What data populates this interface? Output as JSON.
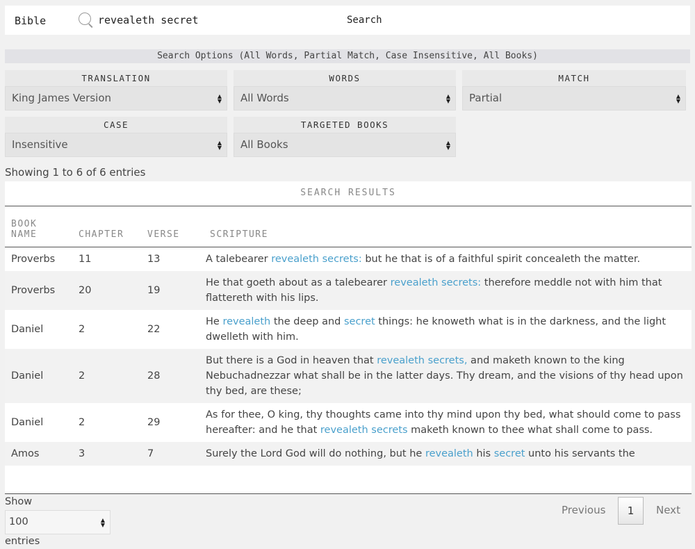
{
  "topbar": {
    "brand": "Bible",
    "search_value": "revealeth secret",
    "search_button": "Search"
  },
  "options": {
    "header": "Search Options (All Words, Partial Match, Case Insensitive, All Books)",
    "translation": {
      "label": "TRANSLATION",
      "value": "King James Version"
    },
    "words": {
      "label": "WORDS",
      "value": "All Words"
    },
    "match": {
      "label": "MATCH",
      "value": "Partial"
    },
    "case": {
      "label": "CASE",
      "value": "Insensitive"
    },
    "books": {
      "label": "TARGETED BOOKS",
      "value": "All Books"
    }
  },
  "showing": "Showing 1 to 6 of 6 entries",
  "results": {
    "title": "SEARCH RESULTS",
    "columns": [
      "BOOK NAME",
      "CHAPTER",
      "VERSE",
      "SCRIPTURE"
    ],
    "highlight_color": "#4aa0cc",
    "rows": [
      {
        "book": "Proverbs",
        "chapter": "11",
        "verse": "13",
        "parts": [
          {
            "t": "A talebearer "
          },
          {
            "t": "revealeth secrets:",
            "hl": true
          },
          {
            "t": " but he that is of a faithful spirit concealeth the matter."
          }
        ]
      },
      {
        "book": "Proverbs",
        "chapter": "20",
        "verse": "19",
        "parts": [
          {
            "t": "He that goeth about as a talebearer "
          },
          {
            "t": "revealeth secrets:",
            "hl": true
          },
          {
            "t": " therefore meddle not with him that flattereth with his lips."
          }
        ]
      },
      {
        "book": "Daniel",
        "chapter": "2",
        "verse": "22",
        "parts": [
          {
            "t": "He "
          },
          {
            "t": "revealeth",
            "hl": true
          },
          {
            "t": " the deep and "
          },
          {
            "t": "secret",
            "hl": true
          },
          {
            "t": " things: he knoweth what is in the darkness, and the light dwelleth with him."
          }
        ]
      },
      {
        "book": "Daniel",
        "chapter": "2",
        "verse": "28",
        "parts": [
          {
            "t": "But there is a God in heaven that "
          },
          {
            "t": "revealeth secrets,",
            "hl": true
          },
          {
            "t": " and maketh known to the king Nebuchadnezzar what shall be in the latter days. Thy dream, and the visions of thy head upon thy bed, are these;"
          }
        ]
      },
      {
        "book": "Daniel",
        "chapter": "2",
        "verse": "29",
        "parts": [
          {
            "t": "As for thee, O king, thy thoughts came into thy mind upon thy bed, what should come to pass hereafter: and he that "
          },
          {
            "t": "revealeth secrets",
            "hl": true
          },
          {
            "t": " maketh known to thee what shall come to pass."
          }
        ]
      },
      {
        "book": "Amos",
        "chapter": "3",
        "verse": "7",
        "parts": [
          {
            "t": "Surely the Lord God will do nothing, but he "
          },
          {
            "t": "revealeth",
            "hl": true
          },
          {
            "t": " his "
          },
          {
            "t": "secret",
            "hl": true
          },
          {
            "t": " unto his servants the"
          }
        ]
      }
    ]
  },
  "footer": {
    "show_label": "Show",
    "page_length": "100",
    "entries_label": "entries",
    "previous": "Previous",
    "current_page": "1",
    "next": "Next"
  }
}
